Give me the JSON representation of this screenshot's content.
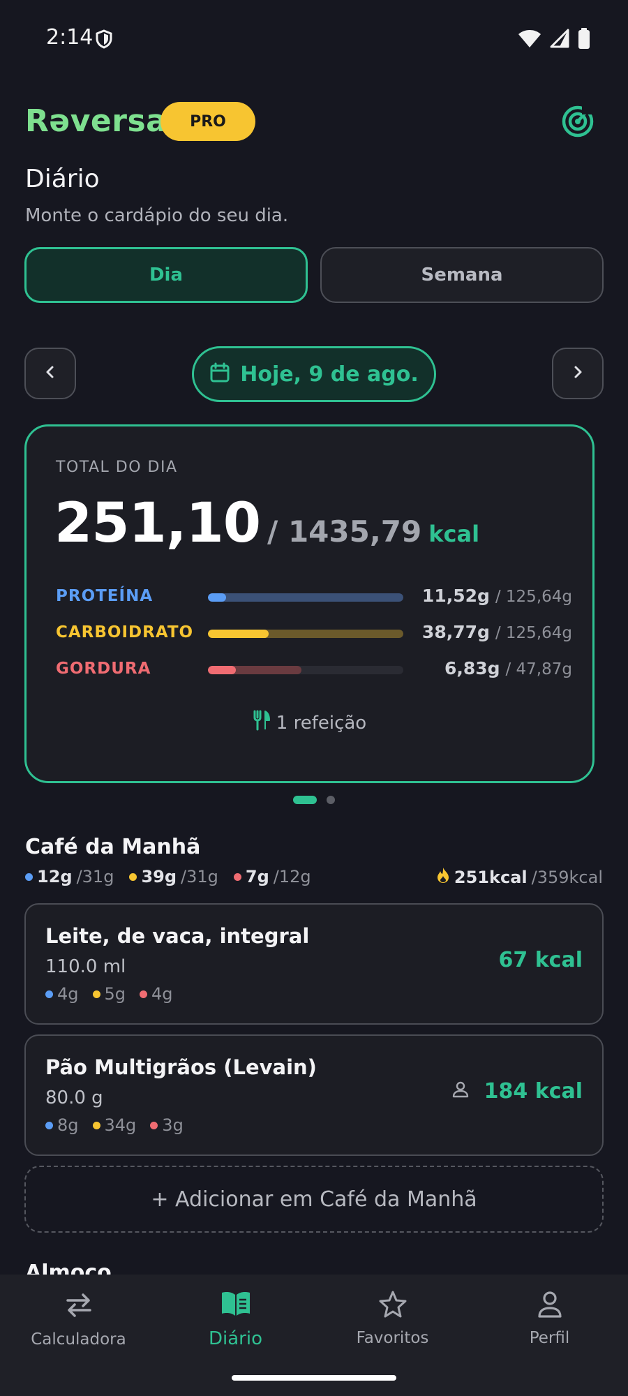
{
  "status_bar": {
    "time": "2:14"
  },
  "header": {
    "logo": "Rəversa",
    "badge": "PRO"
  },
  "page": {
    "title": "Diário",
    "subtitle": "Monte o cardápio do seu dia."
  },
  "tabs": [
    {
      "label": "Dia",
      "selected": true
    },
    {
      "label": "Semana",
      "selected": false
    }
  ],
  "date_nav": {
    "label": "Hoje, 9 de ago."
  },
  "summary": {
    "label": "TOTAL DO DIA",
    "consumed": "251,10",
    "goal": "/ 1435,79",
    "unit": "kcal",
    "macros": [
      {
        "name": "PROTEÍNA",
        "value": "11,52g",
        "goal": "/ 125,64g",
        "fraction": 0.092,
        "target_fraction": 1.0,
        "color": "#5b9df5",
        "track_color": "#3b5177"
      },
      {
        "name": "CARBOIDRATO",
        "value": "38,77g",
        "goal": "/ 125,64g",
        "fraction": 0.309,
        "target_fraction": 1.0,
        "color": "#f7c531",
        "track_color": "#6b5a2b"
      },
      {
        "name": "GORDURA",
        "value": "6,83g",
        "goal": "/ 47,87g",
        "fraction": 0.143,
        "target_fraction": 0.48,
        "color": "#f06c72",
        "track_color": "#6a3b40"
      }
    ],
    "meals_count": "1 refeição"
  },
  "meal": {
    "title": "Café da Manhã",
    "protein": {
      "value": "12g",
      "goal": "/31g"
    },
    "carbs": {
      "value": "39g",
      "goal": "/31g"
    },
    "fat": {
      "value": "7g",
      "goal": "/12g"
    },
    "kcal": {
      "value": "251kcal",
      "goal": "/359kcal"
    },
    "foods": [
      {
        "name": "Leite, de vaca, integral",
        "qty": "110.0 ml",
        "protein": "4g",
        "carbs": "5g",
        "fat": "4g",
        "kcal": "67 kcal"
      },
      {
        "name": "Pão Multigrãos (Levain)",
        "qty": "80.0 g",
        "protein": "8g",
        "carbs": "34g",
        "fat": "3g",
        "kcal": "184 kcal"
      }
    ],
    "add_label": "+ Adicionar em Café da Manhã"
  },
  "next_meal_title": "Almoço",
  "bottom_nav": [
    {
      "label": "Calculadora",
      "icon": "swap-arrows-icon",
      "active": false
    },
    {
      "label": "Diário",
      "icon": "book-icon",
      "active": true
    },
    {
      "label": "Favoritos",
      "icon": "star-icon",
      "active": false
    },
    {
      "label": "Perfil",
      "icon": "person-icon",
      "active": false
    }
  ],
  "colors": {
    "accent": "#2fc192",
    "logo": "#7ee08f",
    "protein": "#5b9df5",
    "carbs": "#f7c531",
    "fat": "#f06c72",
    "pro_badge": "#f7c531"
  }
}
